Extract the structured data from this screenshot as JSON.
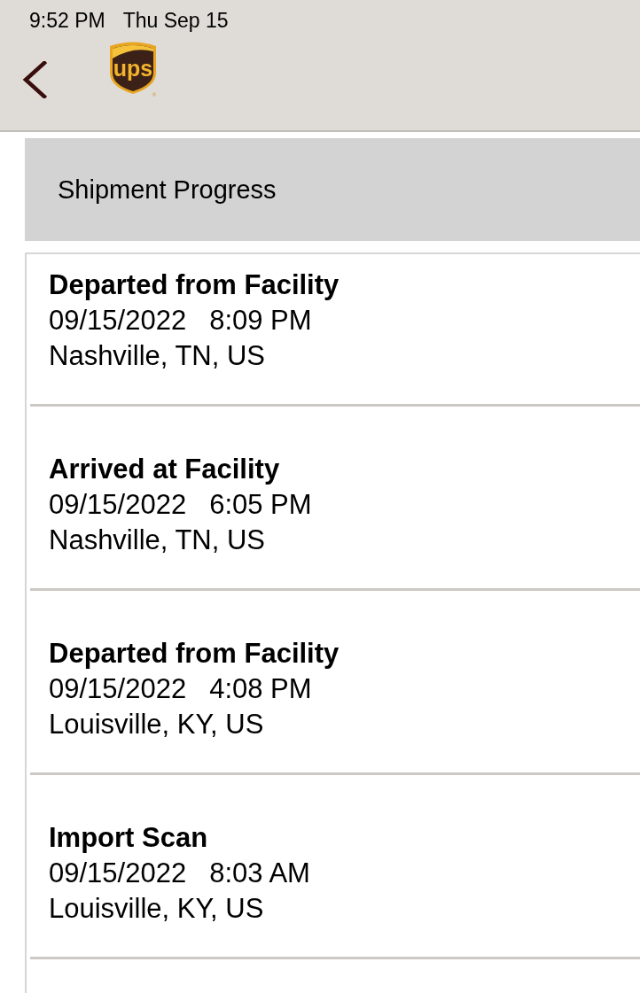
{
  "status_bar": {
    "time": "9:52 PM",
    "date": "Thu Sep 15"
  },
  "nav_bar": {
    "logo": {
      "text": "ups",
      "mark": "®"
    }
  },
  "section": {
    "title": "Shipment Progress"
  },
  "events": [
    {
      "status": "Departed from Facility",
      "date": "09/15/2022",
      "time": "8:09 PM",
      "location": "Nashville, TN, US"
    },
    {
      "status": "Arrived at Facility",
      "date": "09/15/2022",
      "time": "6:05 PM",
      "location": "Nashville, TN, US"
    },
    {
      "status": "Departed from Facility",
      "date": "09/15/2022",
      "time": "4:08 PM",
      "location": "Louisville, KY, US"
    },
    {
      "status": "Import Scan",
      "date": "09/15/2022",
      "time": "8:03 AM",
      "location": "Louisville, KY, US"
    }
  ]
}
